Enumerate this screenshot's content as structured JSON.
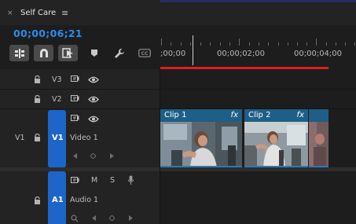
{
  "panel": {
    "title": "Self Care",
    "close_glyph": "×",
    "menu_glyph": "≡"
  },
  "timecode": "00;00;06;21",
  "toolbar": {
    "tools": [
      "insert-nest-icon",
      "snap-magnet-icon",
      "linked-selection-icon",
      "add-marker-icon",
      "wrench-icon",
      "captions-icon"
    ],
    "captions_label": "CC"
  },
  "ruler": {
    "labels": [
      ";00;00",
      "00;00;02;00",
      "00;00;04;00"
    ]
  },
  "tracks": {
    "v3": {
      "name": "V3"
    },
    "v2": {
      "name": "V2"
    },
    "v1": {
      "source_label": "V1",
      "target_label": "V1",
      "name": "Video 1"
    },
    "a1": {
      "target_label": "A1",
      "name": "Audio 1",
      "mute": "M",
      "solo": "S"
    }
  },
  "clips": [
    {
      "name": "Clip 1",
      "fx": "fx"
    },
    {
      "name": "Clip 2",
      "fx": "fx"
    }
  ],
  "colors": {
    "accent_blue": "#2d8ceb",
    "target_blue": "#1d65c9",
    "clip_header": "#1e5f87",
    "work_area_red": "#dd1f1f"
  }
}
